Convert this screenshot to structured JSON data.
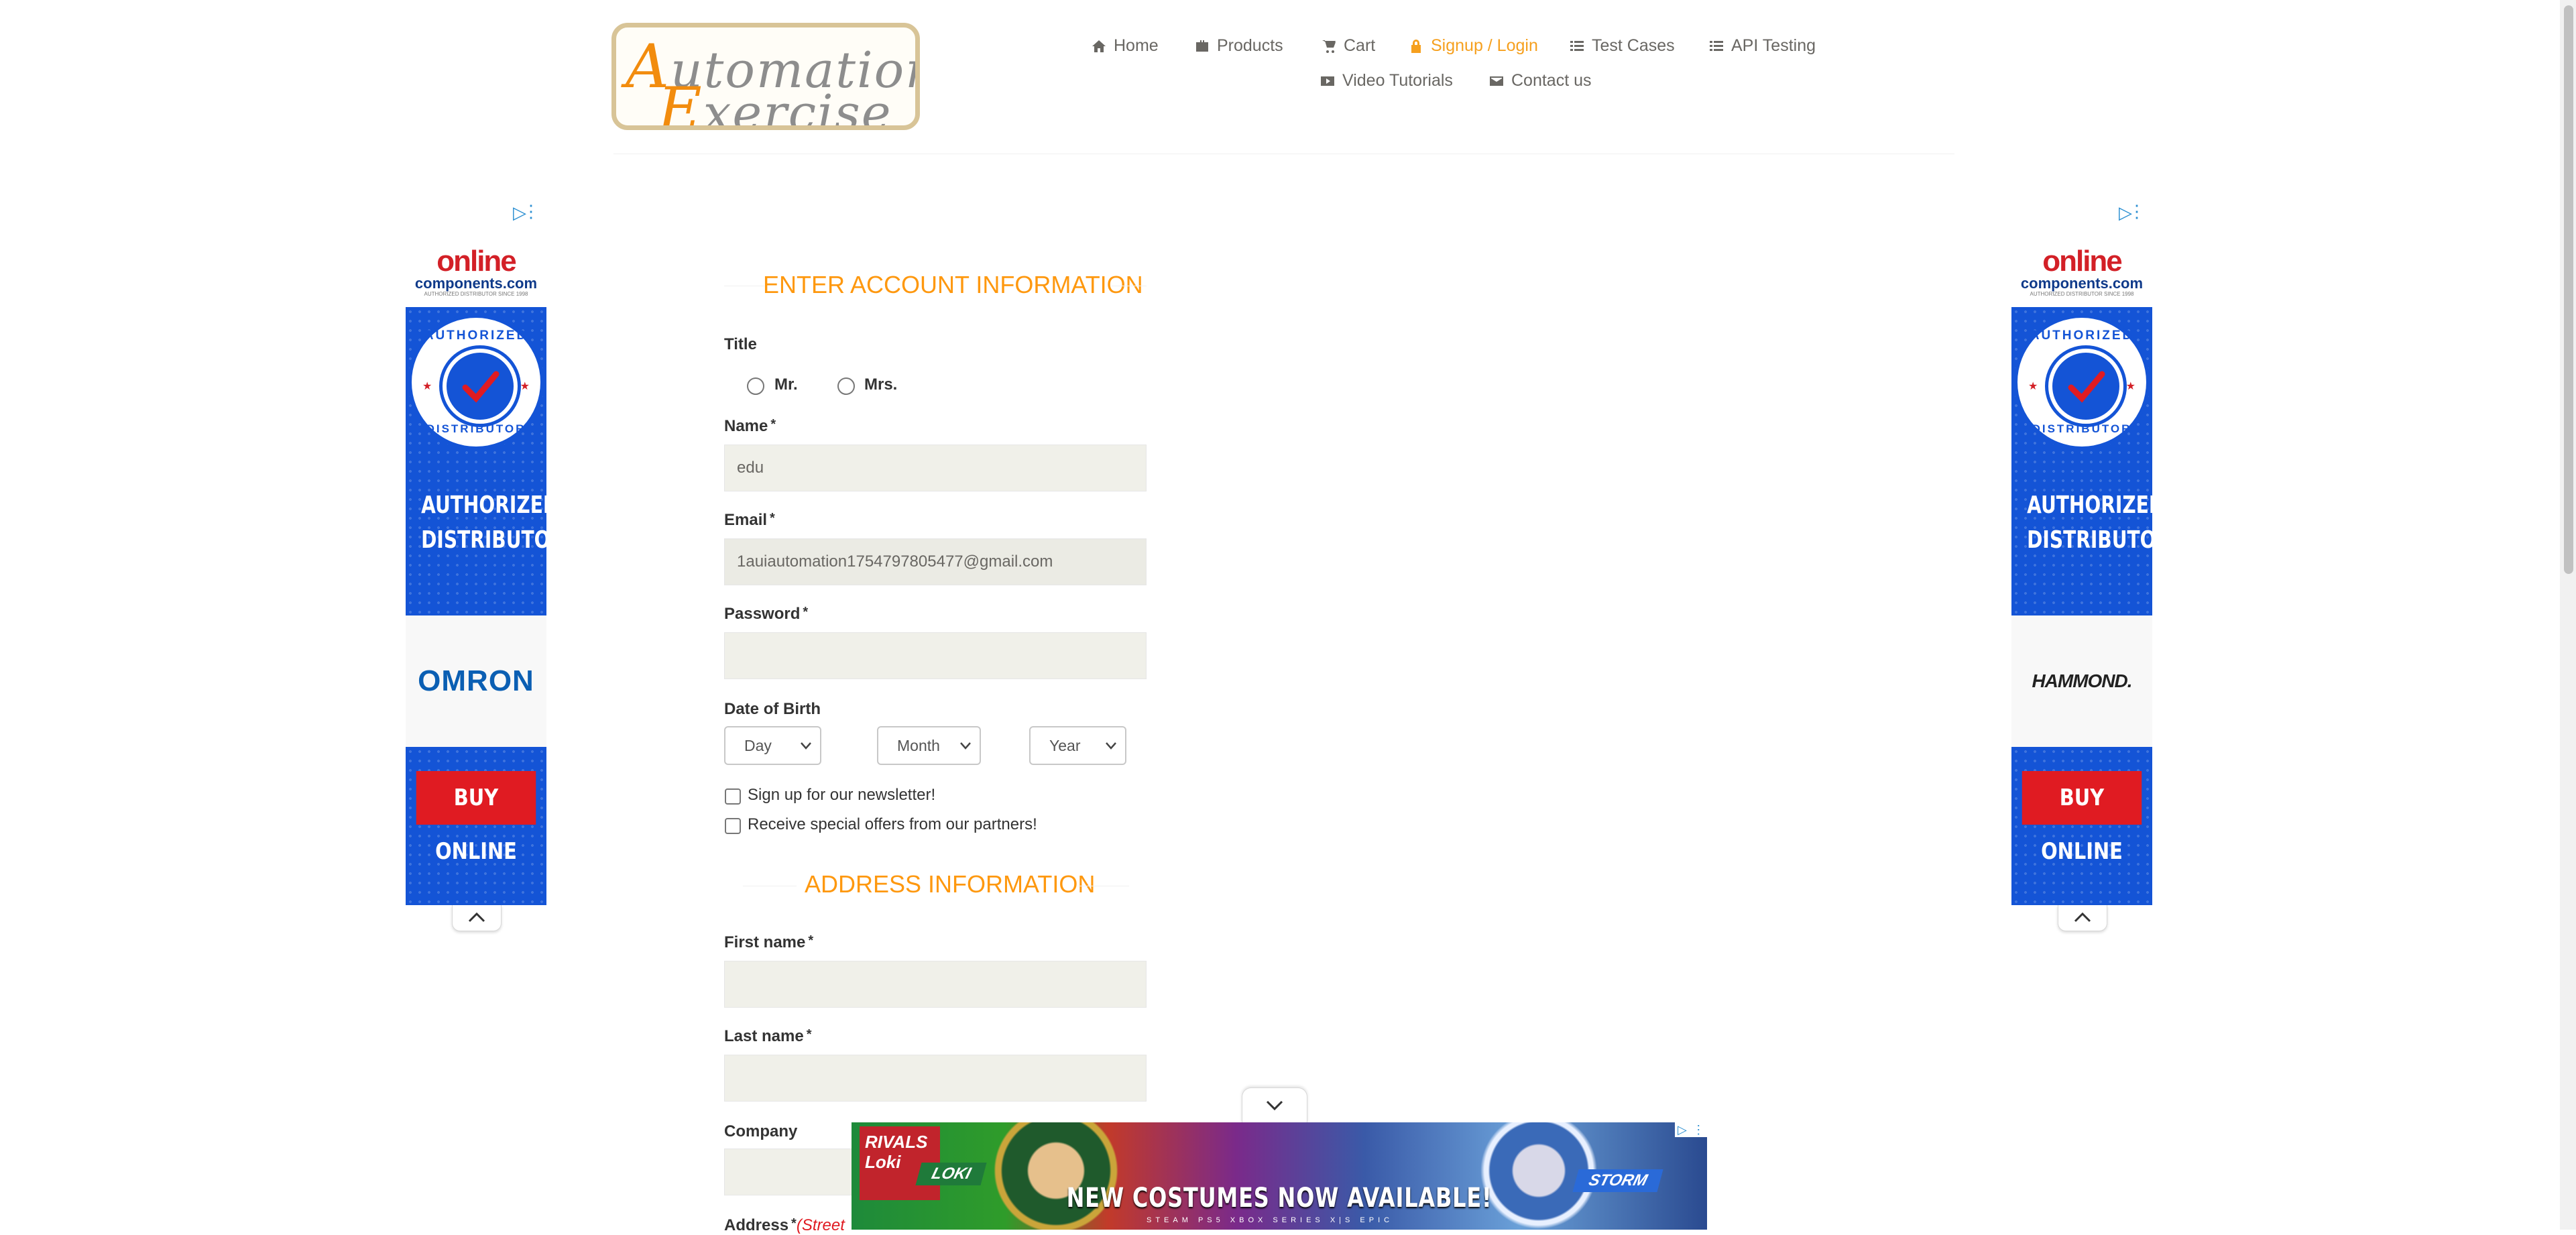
{
  "header": {
    "logo_line1_cap": "A",
    "logo_line1_rest": "utomation",
    "logo_line2_cap": "E",
    "logo_line2_rest": "xercise",
    "nav": [
      {
        "label": "Home",
        "icon": "home-icon"
      },
      {
        "label": "Products",
        "icon": "briefcase-icon"
      },
      {
        "label": "Cart",
        "icon": "cart-icon"
      },
      {
        "label": "Signup / Login",
        "icon": "lock-icon",
        "active": true
      },
      {
        "label": "Test Cases",
        "icon": "list-icon"
      },
      {
        "label": "API Testing",
        "icon": "list-icon"
      },
      {
        "label": "Video Tutorials",
        "icon": "youtube-play-icon"
      },
      {
        "label": "Contact us",
        "icon": "envelope-icon"
      }
    ]
  },
  "side_ads": {
    "brand_top": "online",
    "brand_bottom": "components.com",
    "brand_tagline": "AUTHORIZED DISTRIBUTOR SINCE 1998",
    "badge_top": "AUTHORIZED",
    "badge_bottom": "DISTRIBUTOR",
    "headline_1": "AUTHORIZED",
    "headline_2": "DISTRIBUTOR",
    "left_manufacturer": "OMRON",
    "right_manufacturer": "HAMMOND.",
    "cta": "BUY ONLINE",
    "adchoices_icon": "adchoices-icon"
  },
  "form": {
    "account_section_title": "ENTER ACCOUNT INFORMATION",
    "title_label": "Title",
    "title_options": [
      "Mr.",
      "Mrs."
    ],
    "name_label": "Name",
    "name_value": "edu",
    "email_label": "Email",
    "email_value": "1auiautomation1754797805477@gmail.com",
    "password_label": "Password",
    "password_value": "",
    "required_marker": "*",
    "dob_label": "Date of Birth",
    "dob_day": "Day",
    "dob_month": "Month",
    "dob_year": "Year",
    "newsletter_label": "Sign up for our newsletter!",
    "offers_label": "Receive special offers from our partners!",
    "address_section_title": "ADDRESS INFORMATION",
    "first_name_label": "First name",
    "last_name_label": "Last name",
    "company_label": "Company",
    "address_label": "Address",
    "address_hint": "(Street"
  },
  "bottom_ad": {
    "game_logo": "RIVALS",
    "hero1": "LOKI",
    "hero2": "STORM",
    "headline": "NEW COSTUMES NOW AVAILABLE!",
    "platforms": "STEAM  PS5  XBOX SERIES X|S  EPIC",
    "side_text": "Loki"
  },
  "colors": {
    "accent_orange": "#fe980f",
    "nav_active": "#f6a01e",
    "input_bg": "#f0f0e9"
  }
}
